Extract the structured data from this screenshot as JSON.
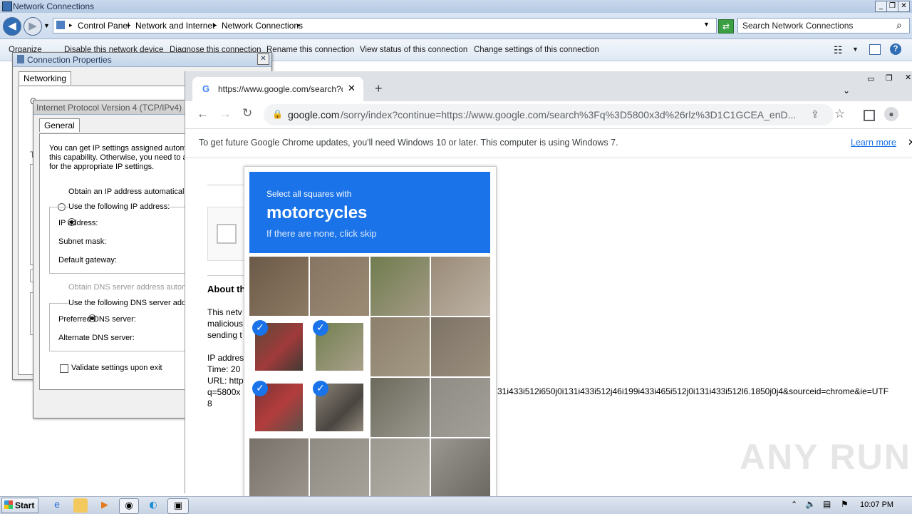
{
  "explorer": {
    "title": "Network Connections",
    "breadcrumb": [
      "Control Panel",
      "Network and Internet",
      "Network Connections"
    ],
    "search_placeholder": "Search Network Connections",
    "toolbar": [
      "Organize",
      "Disable this network device",
      "Diagnose this connection",
      "Rename this connection",
      "View status of this connection",
      "Change settings of this connection"
    ]
  },
  "conn_props": {
    "title": "Connection Properties",
    "tab": "Networking"
  },
  "ipv4": {
    "title": "Internet Protocol Version 4 (TCP/IPv4)",
    "tab": "General",
    "desc": [
      "You can get IP settings assigned automa",
      "this capability. Otherwise, you need to a",
      "for the appropriate IP settings."
    ],
    "obtain_ip": "Obtain an IP address automatically",
    "use_ip": "Use the following IP address:",
    "ip_label": "IP address:",
    "subnet_label": "Subnet mask:",
    "gateway_label": "Default gateway:",
    "obtain_dns": "Obtain DNS server address autom",
    "use_dns": "Use the following DNS server addr",
    "pref_dns": "Preferred DNS server:",
    "alt_dns": "Alternate DNS server:",
    "validate": "Validate settings upon exit"
  },
  "chrome": {
    "tab_title": "https://www.google.com/search?q=",
    "url_host": "google.com",
    "url_rest": "/sorry/index?continue=https://www.google.com/search%3Fq%3D5800x3d%26rlz%3D1C1GCEA_enD...",
    "infobar_text": "To get future Google Chrome updates, you'll need Windows 10 or later. This computer is using Windows 7.",
    "learn_more": "Learn more"
  },
  "sorry_page": {
    "about_heading": "About th",
    "para": [
      "This netv",
      "malicious",
      "sending t"
    ],
    "ip_line": "IP addres",
    "time_line": "Time: 20",
    "url_line": "URL: http",
    "q_line": "q=5800x",
    "url_tail": "31i433i512i650j0i131i433i512j46i199i433i465i512j0i131i433i512l6.1850j0j4&sourceid=chrome&ie=UTF",
    "last_line": "8"
  },
  "captcha": {
    "instruction": "Select all squares with",
    "target": "motorcycles",
    "hint": "If there are none, click skip"
  },
  "watermark": "ANY RUN",
  "taskbar": {
    "start": "Start",
    "clock": "10:07 PM"
  },
  "colors": {
    "accent": "#1a73e8",
    "explorer_bar": "#cddcee"
  }
}
